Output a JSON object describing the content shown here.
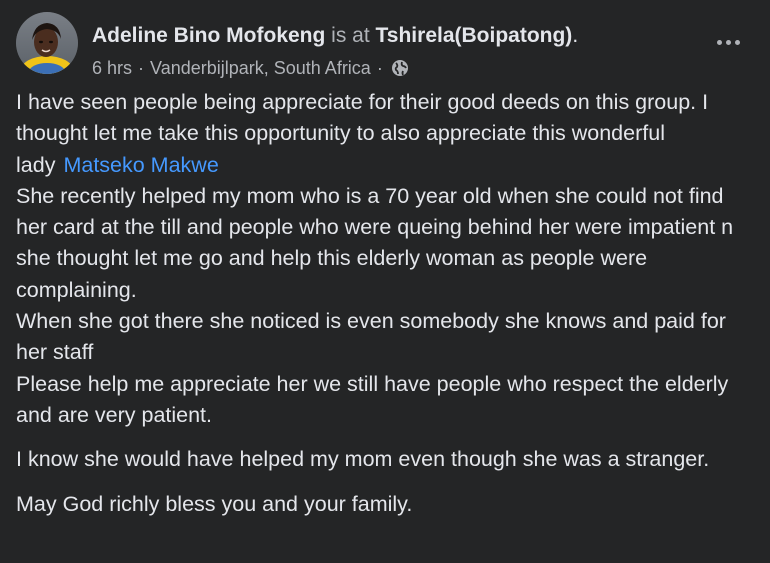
{
  "post": {
    "author": "Adeline Bino Mofokeng",
    "is_at": "is at",
    "place": "Tshirela(Boipatong)",
    "period": ".",
    "time": "6 hrs",
    "separator1": "·",
    "location": "Vanderbijlpark, South Africa",
    "separator2": "·",
    "privacy_icon": "globe-icon",
    "more_icon": "more-options-icon",
    "mention_color": "#4599ff"
  },
  "content": {
    "line1": "I have seen people being appreciate for their good deeds on this group. I thought let me take this opportunity to also appreciate this wonderful lady",
    "mention": "Matseko Makwe",
    "line2": "She recently helped my mom who is a 70 year old when she could not find her card at the till and people who were queing behind her were impatient n she thought let me go and help this elderly woman as people were complaining.",
    "line3": "When she got there she noticed is even somebody she knows and paid for her staff",
    "line4": "Please help me appreciate her we still have people who respect the elderly and are very patient.",
    "para2": "I know she would have helped my mom even though she was a stranger.",
    "para3": "May God richly bless you and your family."
  }
}
